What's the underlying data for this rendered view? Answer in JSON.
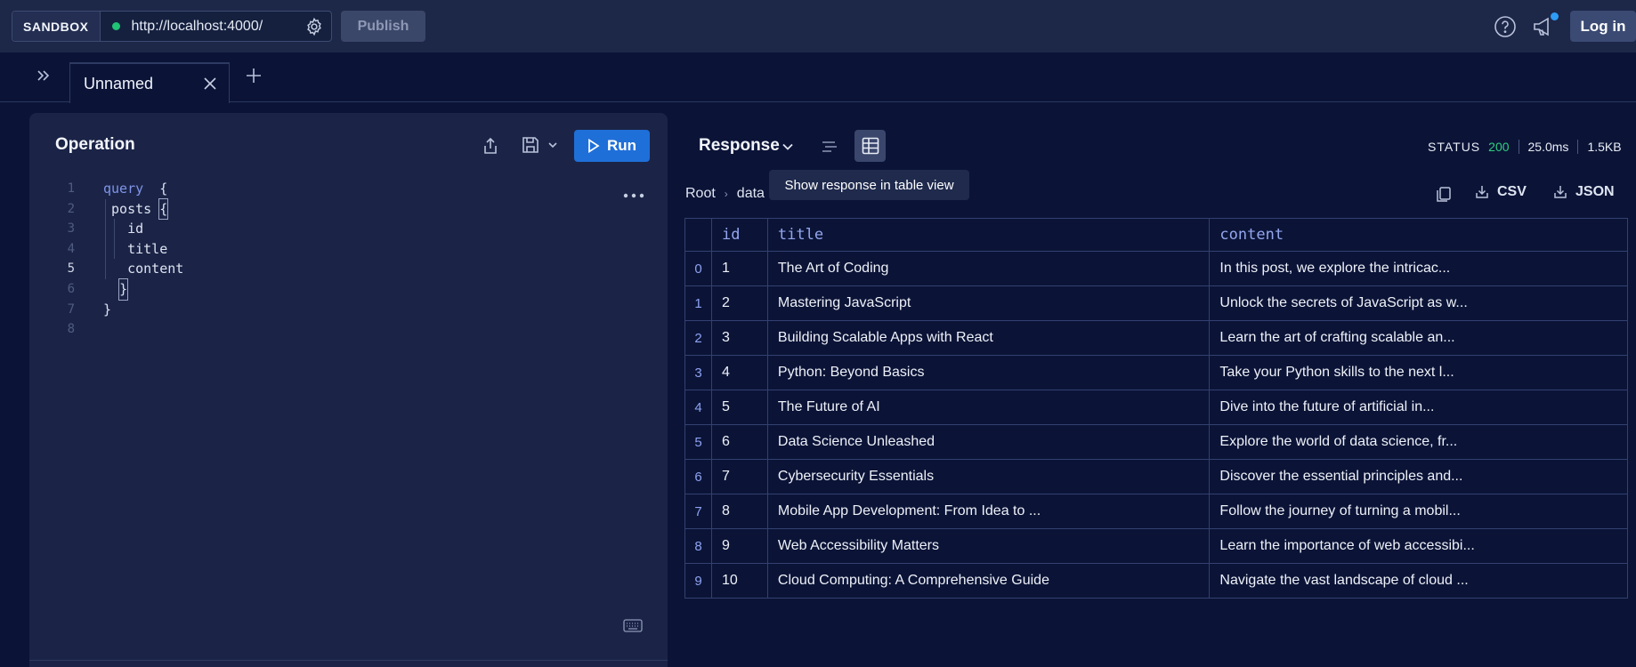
{
  "topbar": {
    "sandbox_label": "SANDBOX",
    "url": "http://localhost:4000/",
    "publish_label": "Publish",
    "login_label": "Log in"
  },
  "tabs": [
    {
      "label": "Unnamed"
    }
  ],
  "operation": {
    "title": "Operation",
    "run_label": "Run",
    "code_lines": [
      {
        "n": "1",
        "text": "query  {"
      },
      {
        "n": "2",
        "text": "posts {"
      },
      {
        "n": "3",
        "text": "id"
      },
      {
        "n": "4",
        "text": "title"
      },
      {
        "n": "5",
        "text": "content"
      },
      {
        "n": "6",
        "text": "}"
      },
      {
        "n": "7",
        "text": "}"
      },
      {
        "n": "8",
        "text": ""
      }
    ],
    "active_line": "5"
  },
  "response": {
    "title": "Response",
    "status_label": "STATUS",
    "status_code": "200",
    "time": "25.0ms",
    "size": "1.5KB",
    "tooltip": "Show response in table view",
    "breadcrumb": [
      "Root",
      "data"
    ],
    "csv_label": "CSV",
    "json_label": "JSON",
    "columns": [
      "id",
      "title",
      "content"
    ],
    "rows": [
      {
        "index": "0",
        "id": "1",
        "title": "The Art of Coding",
        "content": "In this post, we explore the intricac..."
      },
      {
        "index": "1",
        "id": "2",
        "title": "Mastering JavaScript",
        "content": "Unlock the secrets of JavaScript as w..."
      },
      {
        "index": "2",
        "id": "3",
        "title": "Building Scalable Apps with React",
        "content": "Learn the art of crafting scalable an..."
      },
      {
        "index": "3",
        "id": "4",
        "title": "Python: Beyond Basics",
        "content": "Take your Python skills to the next l..."
      },
      {
        "index": "4",
        "id": "5",
        "title": "The Future of AI",
        "content": "Dive into the future of artificial in..."
      },
      {
        "index": "5",
        "id": "6",
        "title": "Data Science Unleashed",
        "content": "Explore the world of data science, fr..."
      },
      {
        "index": "6",
        "id": "7",
        "title": "Cybersecurity Essentials",
        "content": "Discover the essential principles and..."
      },
      {
        "index": "7",
        "id": "8",
        "title": "Mobile App Development: From Idea to ...",
        "content": "Follow the journey of turning a mobil..."
      },
      {
        "index": "8",
        "id": "9",
        "title": "Web Accessibility Matters",
        "content": "Learn the importance of web accessibi..."
      },
      {
        "index": "9",
        "id": "10",
        "title": "Cloud Computing: A Comprehensive Guide",
        "content": "Navigate the vast landscape of cloud ..."
      }
    ]
  },
  "colors": {
    "background": "#0b1437",
    "topbar": "#1d2748",
    "panel": "#1b2447",
    "run_button": "#1f6fd9",
    "status_ok": "#2fce7e",
    "status_dot": "#20c274",
    "keyword": "#7f95e8"
  },
  "icons": [
    "gear-icon",
    "help-icon",
    "megaphone-icon",
    "expand-sidebar-icon",
    "close-icon",
    "plus-icon",
    "share-icon",
    "save-icon",
    "chevron-down-icon",
    "play-icon",
    "more-icon",
    "keyboard-icon",
    "list-view-icon",
    "table-view-icon",
    "copy-icon",
    "download-icon"
  ]
}
